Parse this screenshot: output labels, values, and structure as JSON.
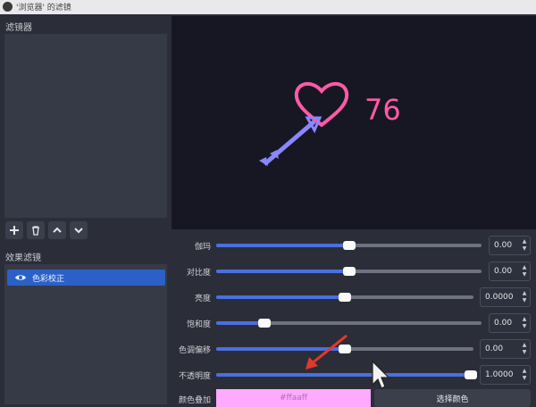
{
  "window": {
    "title": "'浏览器' 的滤镜"
  },
  "sidebar": {
    "filters_title": "滤镜器",
    "effects_title": "效果滤镜",
    "effect_items": [
      {
        "label": "色彩校正",
        "visible": true
      }
    ]
  },
  "preview": {
    "counter": "76",
    "heart_color": "#ff5aa8",
    "arrow_color": "#8a86ff"
  },
  "controls": [
    {
      "label": "伽玛",
      "value": "0.00",
      "fraction": 0.5
    },
    {
      "label": "对比度",
      "value": "0.00",
      "fraction": 0.5
    },
    {
      "label": "亮度",
      "value": "0.0000",
      "fraction": 0.5
    },
    {
      "label": "饱和度",
      "value": "0.00",
      "fraction": 0.18
    },
    {
      "label": "色调偏移",
      "value": "0.00",
      "fraction": 0.5
    },
    {
      "label": "不透明度",
      "value": "1.0000",
      "fraction": 1.0
    }
  ],
  "color_overlay": {
    "label": "颜色叠加",
    "value": "#ffaaff",
    "button_label": "选择颜色"
  },
  "colors": {
    "accent": "#4a6fe0",
    "selected": "#2b61c6"
  }
}
